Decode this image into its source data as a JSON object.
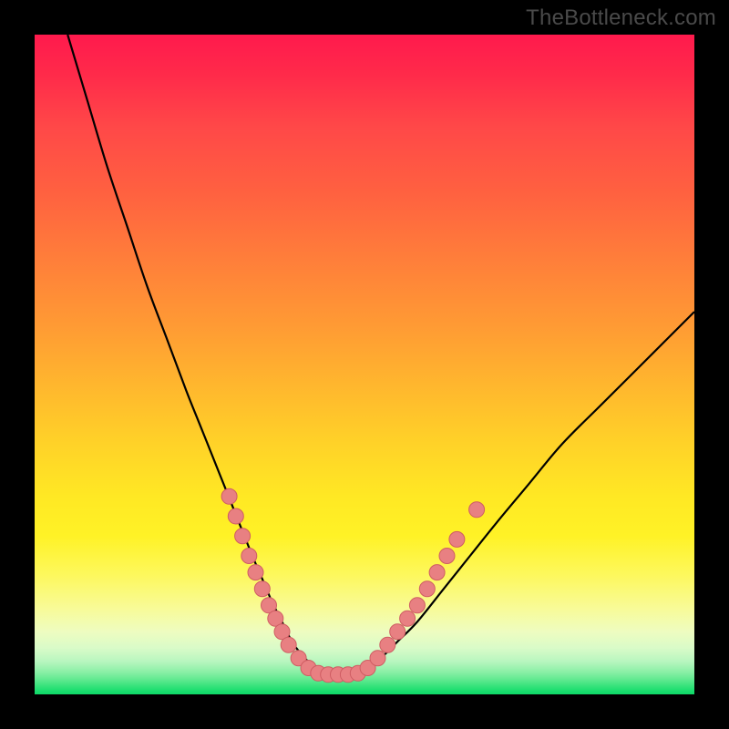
{
  "watermark": "TheBottleneck.com",
  "colors": {
    "curve": "#000000",
    "markers_fill": "#e88082",
    "markers_stroke": "#cf5d63"
  },
  "chart_data": {
    "type": "line",
    "title": "",
    "xlabel": "",
    "ylabel": "",
    "xlim": [
      0,
      100
    ],
    "ylim": [
      0,
      100
    ],
    "series": [
      {
        "name": "bottleneck-curve",
        "x": [
          5,
          8,
          11,
          14,
          17,
          20,
          23,
          25,
          27,
          29,
          31,
          33,
          34.5,
          36,
          37.5,
          39,
          40.5,
          42,
          43.5,
          45,
          47,
          49,
          51,
          53,
          55,
          58,
          62,
          66,
          70,
          75,
          80,
          86,
          92,
          100
        ],
        "y": [
          100,
          90,
          80,
          71,
          62,
          54,
          46,
          41,
          36,
          31,
          26,
          21,
          17.5,
          14,
          11,
          8,
          6,
          4.5,
          3.5,
          3,
          3,
          3.5,
          4.5,
          6,
          8,
          11,
          16,
          21,
          26,
          32,
          38,
          44,
          50,
          58
        ]
      }
    ],
    "markers": [
      {
        "x": 29.5,
        "y": 30
      },
      {
        "x": 30.5,
        "y": 27
      },
      {
        "x": 31.5,
        "y": 24
      },
      {
        "x": 32.5,
        "y": 21
      },
      {
        "x": 33.5,
        "y": 18.5
      },
      {
        "x": 34.5,
        "y": 16
      },
      {
        "x": 35.5,
        "y": 13.5
      },
      {
        "x": 36.5,
        "y": 11.5
      },
      {
        "x": 37.5,
        "y": 9.5
      },
      {
        "x": 38.5,
        "y": 7.5
      },
      {
        "x": 40,
        "y": 5.5
      },
      {
        "x": 41.5,
        "y": 4
      },
      {
        "x": 43,
        "y": 3.2
      },
      {
        "x": 44.5,
        "y": 3
      },
      {
        "x": 46,
        "y": 3
      },
      {
        "x": 47.5,
        "y": 3
      },
      {
        "x": 49,
        "y": 3.2
      },
      {
        "x": 50.5,
        "y": 4
      },
      {
        "x": 52,
        "y": 5.5
      },
      {
        "x": 53.5,
        "y": 7.5
      },
      {
        "x": 55,
        "y": 9.5
      },
      {
        "x": 56.5,
        "y": 11.5
      },
      {
        "x": 58,
        "y": 13.5
      },
      {
        "x": 59.5,
        "y": 16
      },
      {
        "x": 61,
        "y": 18.5
      },
      {
        "x": 62.5,
        "y": 21
      },
      {
        "x": 64,
        "y": 23.5
      },
      {
        "x": 67,
        "y": 28
      }
    ]
  }
}
